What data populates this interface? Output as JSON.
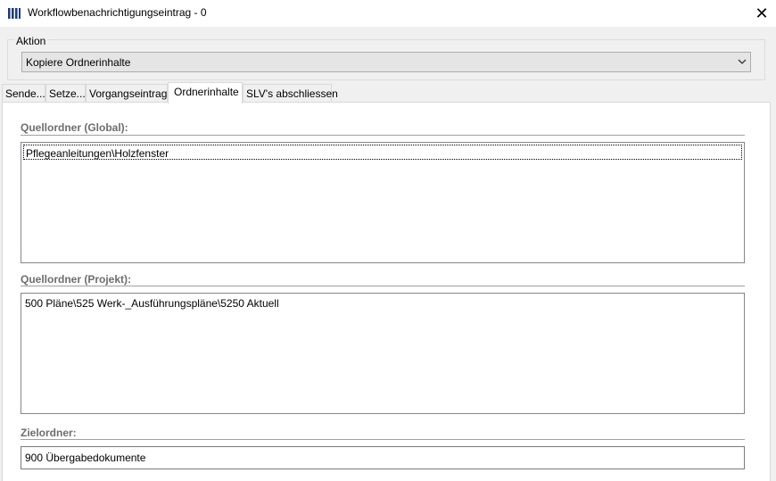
{
  "window": {
    "title": "Workflowbenachrichtigungseintrag - 0",
    "close_glyph": "✕",
    "app_icon": "barcode-icon"
  },
  "aktion": {
    "legend": "Aktion",
    "selected": "Kopiere Ordnerinhalte",
    "dropdown_icon": "chevron-down-icon"
  },
  "tabs": [
    {
      "label": "Sende...",
      "active": false
    },
    {
      "label": "Setze...",
      "active": false
    },
    {
      "label": "Vorgangseintrag",
      "active": false
    },
    {
      "label": "Ordnerinhalte",
      "active": true
    },
    {
      "label": "SLV's abschliessen",
      "active": false
    }
  ],
  "sections": {
    "global": {
      "label": "Quellordner (Global):",
      "items": [
        "Pflegeanleitungen\\Holzfenster"
      ]
    },
    "projekt": {
      "label": "Quellordner (Projekt):",
      "items": [
        "500 Pläne\\525 Werk-_Ausführungspläne\\5250 Aktuell"
      ]
    },
    "ziel": {
      "label": "Zielordner:",
      "value": "900 Übergabedokumente"
    }
  }
}
